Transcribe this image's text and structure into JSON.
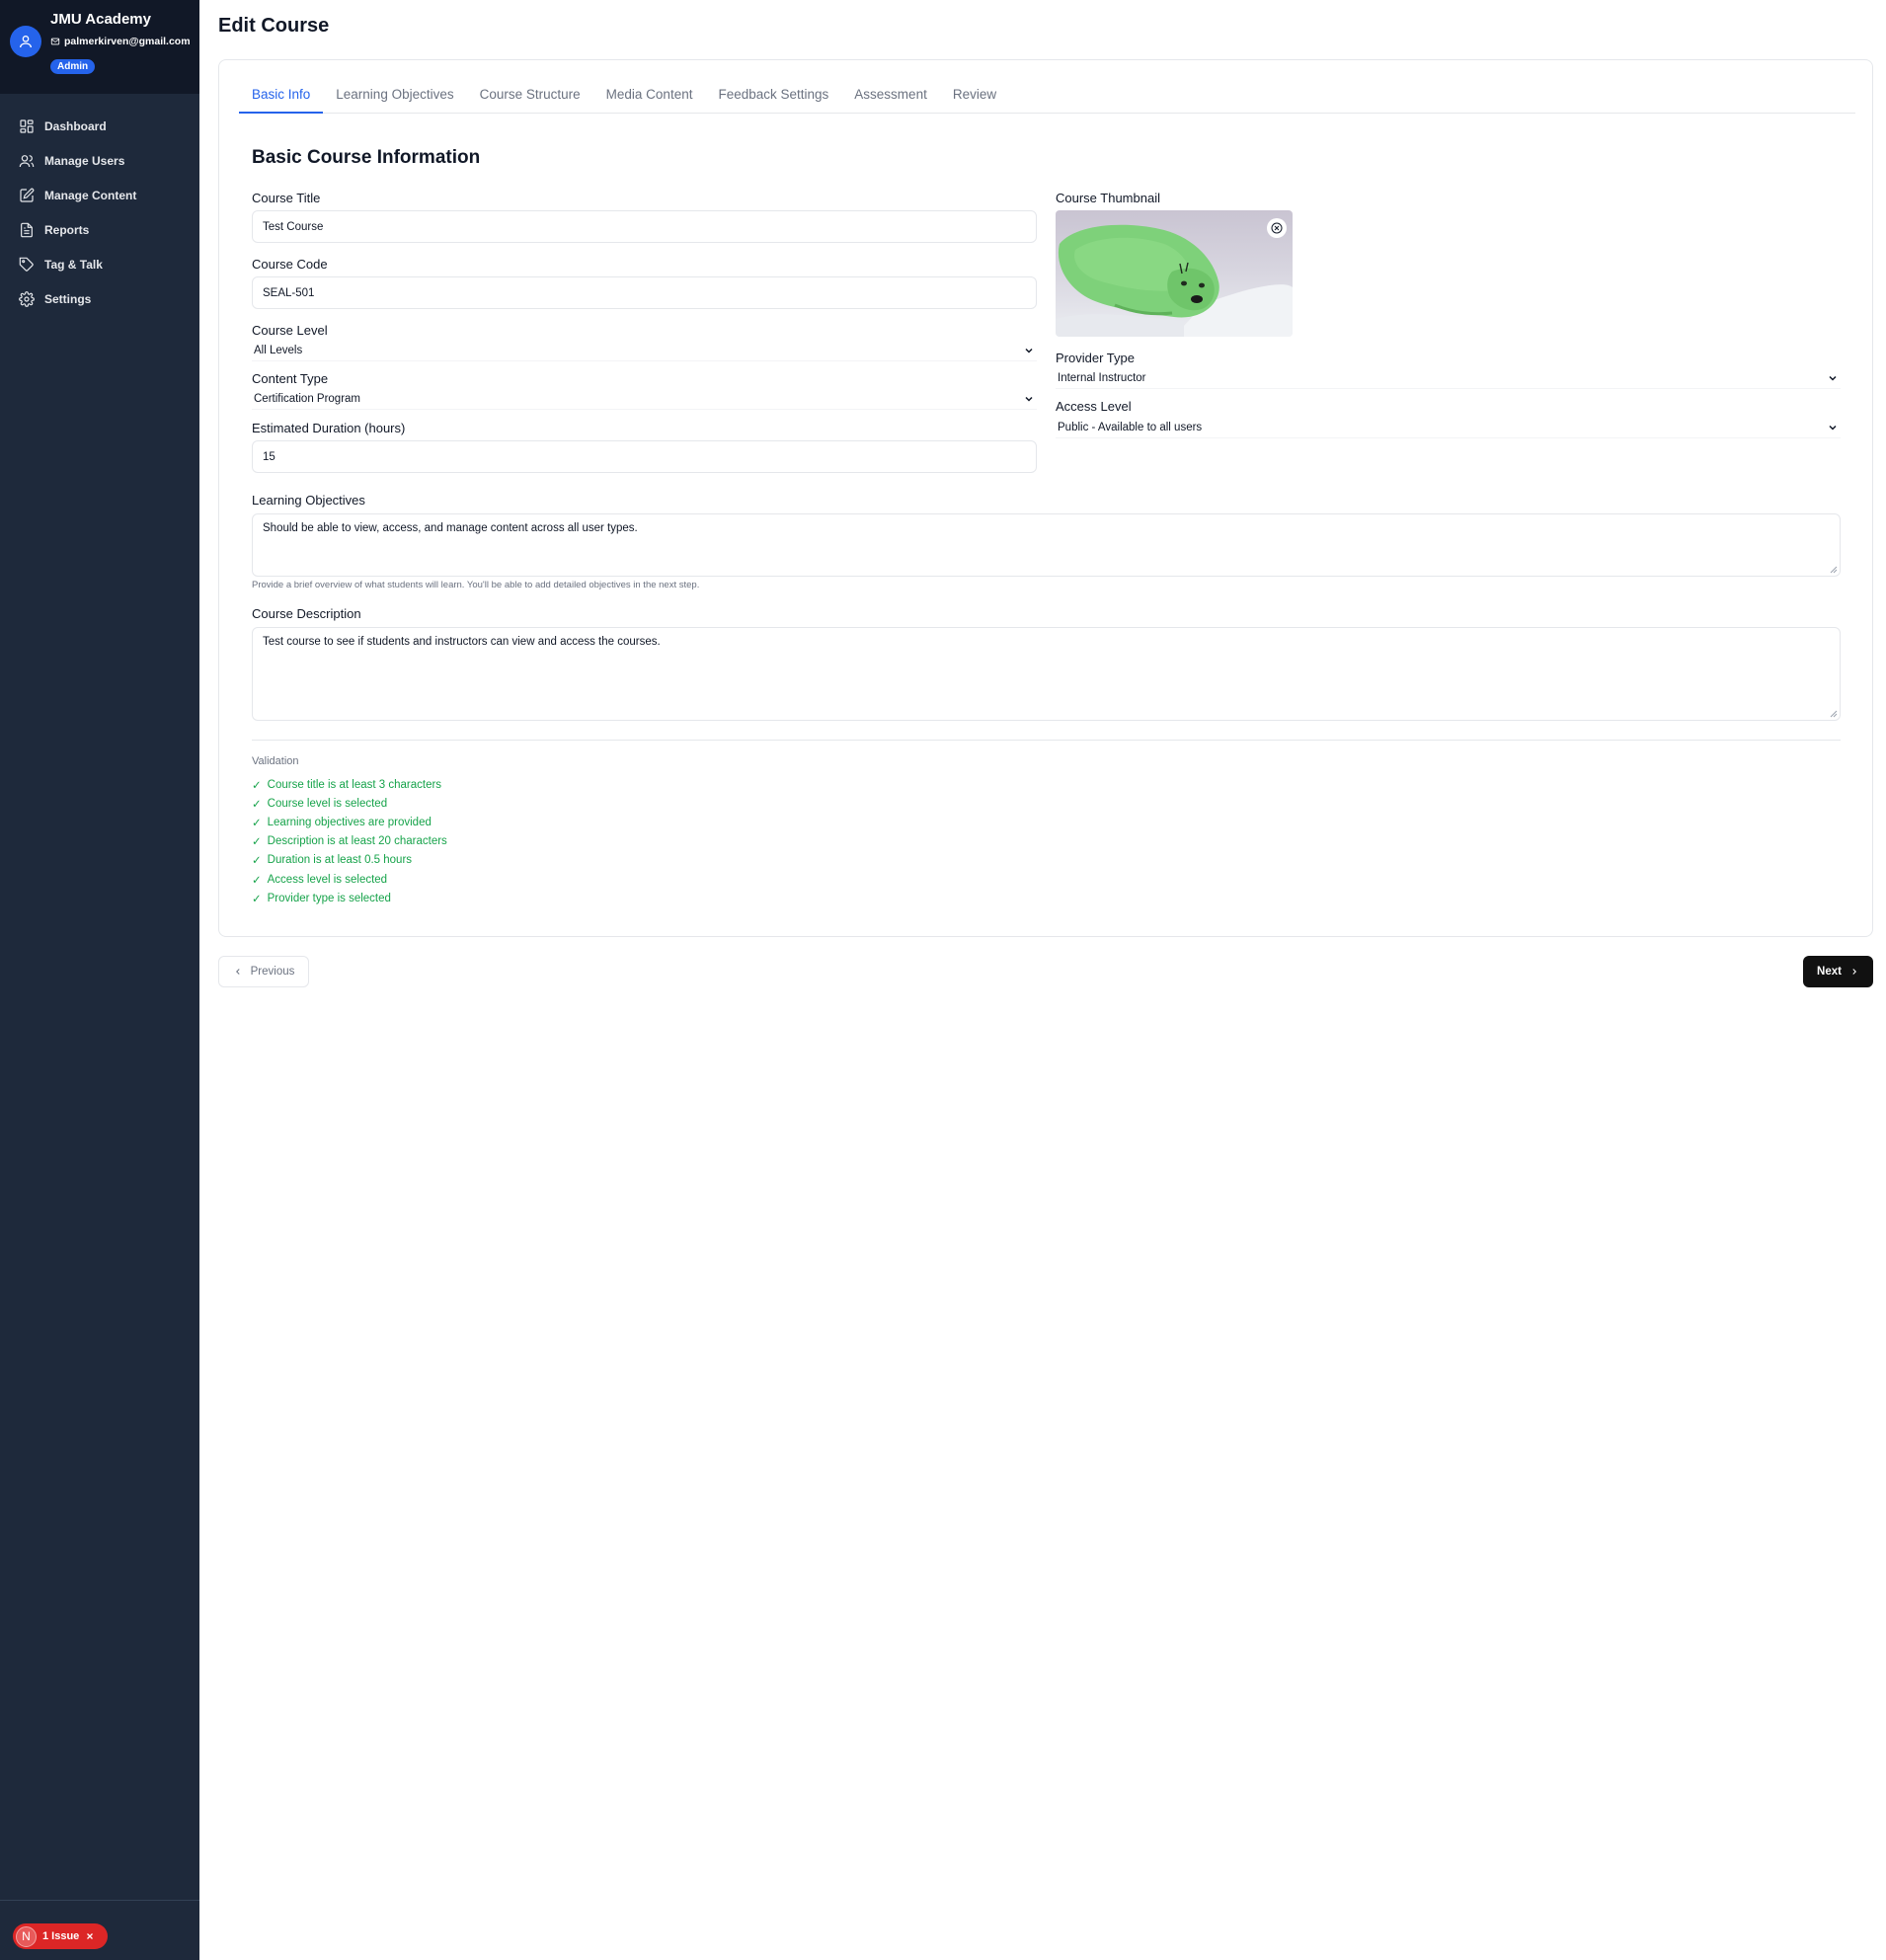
{
  "sidebar": {
    "brand": "JMU Academy",
    "email": "palmerkirven@gmail.com",
    "role": "Admin",
    "items": [
      {
        "label": "Dashboard",
        "icon": "dashboard-icon"
      },
      {
        "label": "Manage Users",
        "icon": "users-icon"
      },
      {
        "label": "Manage Content",
        "icon": "edit-icon"
      },
      {
        "label": "Reports",
        "icon": "report-icon"
      },
      {
        "label": "Tag & Talk",
        "icon": "tag-icon"
      },
      {
        "label": "Settings",
        "icon": "gear-icon"
      }
    ],
    "issue": {
      "badge": "N",
      "label": "1 Issue"
    }
  },
  "page": {
    "title": "Edit Course",
    "tabs": [
      "Basic Info",
      "Learning Objectives",
      "Course Structure",
      "Media Content",
      "Feedback Settings",
      "Assessment",
      "Review"
    ],
    "active_tab": "Basic Info",
    "section_title": "Basic Course Information"
  },
  "form": {
    "course_title": {
      "label": "Course Title",
      "value": "Test Course"
    },
    "course_code": {
      "label": "Course Code",
      "value": "SEAL-501"
    },
    "course_level": {
      "label": "Course Level",
      "value": "All Levels"
    },
    "content_type": {
      "label": "Content Type",
      "value": "Certification Program"
    },
    "duration": {
      "label": "Estimated Duration (hours)",
      "value": "15"
    },
    "thumbnail": {
      "label": "Course Thumbnail"
    },
    "provider_type": {
      "label": "Provider Type",
      "value": "Internal Instructor"
    },
    "access_level": {
      "label": "Access Level",
      "value": "Public - Available to all users"
    },
    "learning_objectives": {
      "label": "Learning Objectives",
      "value": "Should be able to view, access, and manage content across all user types.",
      "hint": "Provide a brief overview of what students will learn. You'll be able to add detailed objectives in the next step."
    },
    "description": {
      "label": "Course Description",
      "value": "Test course to see if students and instructors can view and access the courses."
    }
  },
  "validation": {
    "title": "Validation",
    "check": "✓",
    "items": [
      "Course title is at least 3 characters",
      "Course level is selected",
      "Learning objectives are provided",
      "Description is at least 20 characters",
      "Duration is at least 0.5 hours",
      "Access level is selected",
      "Provider type is selected"
    ]
  },
  "footer": {
    "previous": "Previous",
    "next": "Next"
  },
  "colors": {
    "accent": "#2563eb",
    "sidebar": "#1e293b",
    "success": "#16a34a",
    "danger": "#dc2626"
  }
}
